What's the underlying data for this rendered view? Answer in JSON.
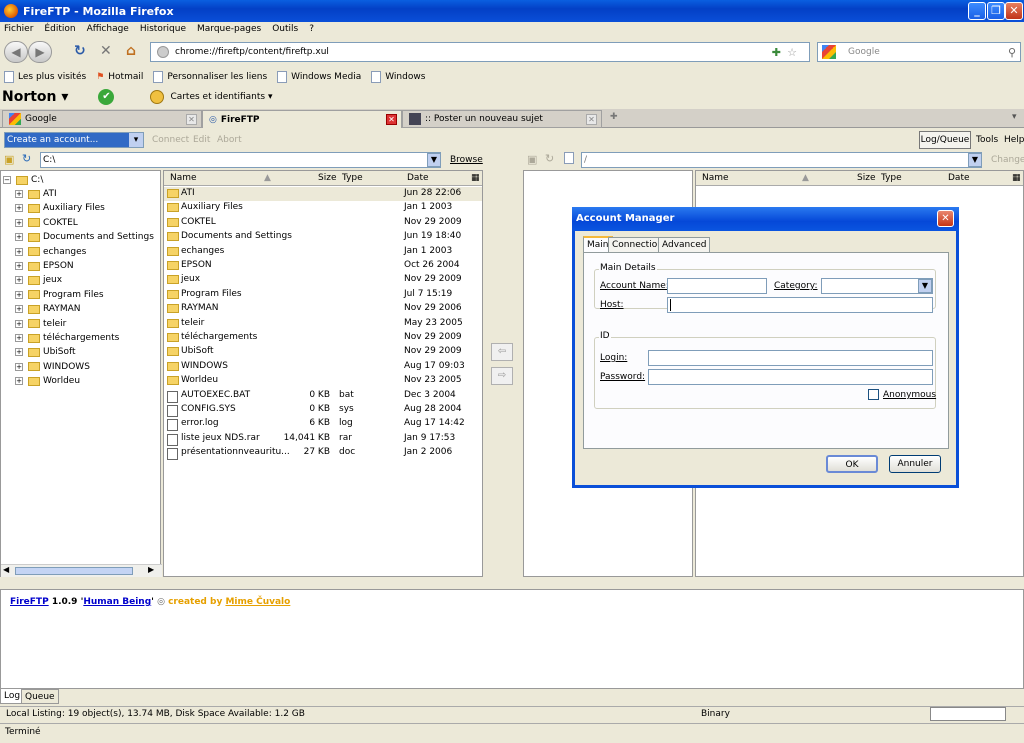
{
  "window": {
    "title": "FireFTP - Mozilla Firefox"
  },
  "menu": [
    "Fichier",
    "Édition",
    "Affichage",
    "Historique",
    "Marque-pages",
    "Outils",
    "?"
  ],
  "navbar": {
    "url": "chrome://fireftp/content/fireftp.xul",
    "search_placeholder": "Google"
  },
  "bookmarks": [
    "Les plus visités",
    "Hotmail",
    "Personnaliser les liens",
    "Windows Media",
    "Windows"
  ],
  "norton": {
    "logo": "Norton",
    "cards_label": "Cartes et identifiants"
  },
  "tabs": [
    {
      "label": "Google"
    },
    {
      "label": "FireFTP"
    },
    {
      "label": ":: Poster un nouveau sujet"
    }
  ],
  "ftp_toolbar": {
    "account_select": "Create an account...",
    "connect": "Connect",
    "edit": "Edit",
    "abort": "Abort",
    "log_queue": "Log/Queue",
    "tools": "Tools",
    "help": "Help"
  },
  "local": {
    "path": "C:\\",
    "browse": "Browse",
    "tree_root": "C:\\",
    "tree": [
      "ATI",
      "Auxiliary Files",
      "COKTEL",
      "Documents and Settings",
      "echanges",
      "EPSON",
      "jeux",
      "Program Files",
      "RAYMAN",
      "teleir",
      "téléchargements",
      "UbiSoft",
      "WINDOWS",
      "Worldeu"
    ],
    "columns": {
      "name": "Name",
      "size": "Size",
      "type": "Type",
      "date": "Date"
    },
    "files": [
      {
        "name": "ATI",
        "size": "",
        "type": "",
        "date": "Jun 28 22:06",
        "icon": "folder"
      },
      {
        "name": "Auxiliary Files",
        "size": "",
        "type": "",
        "date": "Jan 1 2003",
        "icon": "folder"
      },
      {
        "name": "COKTEL",
        "size": "",
        "type": "",
        "date": "Nov 29 2009",
        "icon": "folder"
      },
      {
        "name": "Documents and Settings",
        "size": "",
        "type": "",
        "date": "Jun 19 18:40",
        "icon": "folder"
      },
      {
        "name": "echanges",
        "size": "",
        "type": "",
        "date": "Jan 1 2003",
        "icon": "folder"
      },
      {
        "name": "EPSON",
        "size": "",
        "type": "",
        "date": "Oct 26 2004",
        "icon": "folder"
      },
      {
        "name": "jeux",
        "size": "",
        "type": "",
        "date": "Nov 29 2009",
        "icon": "folder"
      },
      {
        "name": "Program Files",
        "size": "",
        "type": "",
        "date": "Jul 7 15:19",
        "icon": "folder"
      },
      {
        "name": "RAYMAN",
        "size": "",
        "type": "",
        "date": "Nov 29 2006",
        "icon": "folder"
      },
      {
        "name": "teleir",
        "size": "",
        "type": "",
        "date": "May 23 2005",
        "icon": "folder"
      },
      {
        "name": "téléchargements",
        "size": "",
        "type": "",
        "date": "Nov 29 2009",
        "icon": "folder"
      },
      {
        "name": "UbiSoft",
        "size": "",
        "type": "",
        "date": "Nov 29 2009",
        "icon": "folder"
      },
      {
        "name": "WINDOWS",
        "size": "",
        "type": "",
        "date": "Aug 17 09:03",
        "icon": "folder"
      },
      {
        "name": "Worldeu",
        "size": "",
        "type": "",
        "date": "Nov 23 2005",
        "icon": "folder"
      },
      {
        "name": "AUTOEXEC.BAT",
        "size": "0 KB",
        "type": "bat",
        "date": "Dec 3 2004",
        "icon": "file"
      },
      {
        "name": "CONFIG.SYS",
        "size": "0 KB",
        "type": "sys",
        "date": "Aug 28 2004",
        "icon": "file"
      },
      {
        "name": "error.log",
        "size": "6 KB",
        "type": "log",
        "date": "Aug 17 14:42",
        "icon": "file"
      },
      {
        "name": "liste jeux NDS.rar",
        "size": "14,041 KB",
        "type": "rar",
        "date": "Jan 9 17:53",
        "icon": "file"
      },
      {
        "name": "présentationnveauritu...",
        "size": "27 KB",
        "type": "doc",
        "date": "Jan 2 2006",
        "icon": "file"
      }
    ]
  },
  "remote": {
    "path": "/",
    "change": "Change",
    "columns": {
      "name": "Name",
      "size": "Size",
      "type": "Type",
      "date": "Date"
    }
  },
  "log": {
    "app": "FireFTP",
    "version": "1.0.9",
    "codename": "Human Being",
    "created_by": "created by",
    "author": "Mime Čuvalo"
  },
  "log_tabs": [
    "Log",
    "Queue"
  ],
  "status": {
    "local_listing": "Local Listing: 19 object(s), 13.74 MB, Disk Space Available: 1.2 GB",
    "mode": "Binary",
    "browser_status": "Terminé"
  },
  "dialog": {
    "title": "Account Manager",
    "tabs": [
      "Main",
      "Connection",
      "Advanced"
    ],
    "main_details": "Main Details",
    "account_name": "Account Name:",
    "category": "Category:",
    "host": "Host:",
    "id_group": "ID",
    "login": "Login:",
    "password": "Password:",
    "anonymous": "Anonymous",
    "ok": "OK",
    "cancel": "Annuler"
  }
}
